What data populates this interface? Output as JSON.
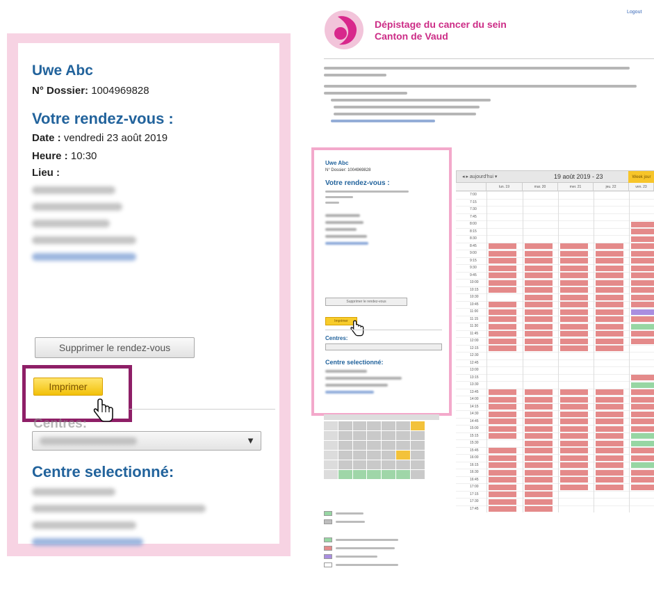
{
  "zoom": {
    "patient_name": "Uwe Abc",
    "dossier_label": "N° Dossier:",
    "dossier_value": " 1004969828",
    "rdv_title": "Votre rendez-vous :",
    "date_label": "Date :",
    "date_value": " vendredi 23 août 2019",
    "heure_label": "Heure :",
    "heure_value": " 10:30",
    "lieu_label": "Lieu :",
    "supprimer_label": "Supprimer le rendez-vous",
    "imprimer_label": "Imprimer",
    "centres_label": "Centres:",
    "centre_selectionne_title": "Centre selectionné:"
  },
  "site": {
    "title_line1": "Dépistage du cancer du sein",
    "title_line2": "Canton de Vaud",
    "logout": "Logout"
  },
  "panel": {
    "patient_name": "Uwe Abc",
    "dossier": "N° Dossier: 1004969828",
    "rdv_title": "Votre rendez-vous :",
    "supprimer_label": "Supprimer le rendez-vous",
    "imprimer_label": "Imprimer",
    "centres_label": "Centres:",
    "centre_selectionne_title": "Centre selectionné:"
  },
  "calendar": {
    "title": "19 août 2019 - 23",
    "nav": "◂ ▸ aujourd'hui ▾",
    "week_button": "Week jour",
    "days": [
      "lun. 19",
      "mar. 20",
      "mer. 21",
      "jeu. 22",
      "ven. 23"
    ],
    "times": [
      "7:00",
      "7:15",
      "7:30",
      "7:45",
      "8:00",
      "8:15",
      "8:30",
      "8:45",
      "9:00",
      "9:15",
      "9:30",
      "9:45",
      "10:00",
      "10:15",
      "10:30",
      "10:45",
      "11:00",
      "11:15",
      "11:30",
      "11:45",
      "12:00",
      "12:15",
      "12:30",
      "12:45",
      "13:00",
      "13:15",
      "13:30",
      "13:45",
      "14:00",
      "14:15",
      "14:30",
      "14:45",
      "15:00",
      "15:15",
      "15:30",
      "15:45",
      "16:00",
      "16:15",
      "16:30",
      "16:45",
      "17:00",
      "17:15",
      "17:30",
      "17:45"
    ],
    "colors": {
      "booked": "#e48a8a",
      "available": "#97d6a3",
      "mine": "#a98ee0",
      "empty": "#ffffff"
    }
  }
}
